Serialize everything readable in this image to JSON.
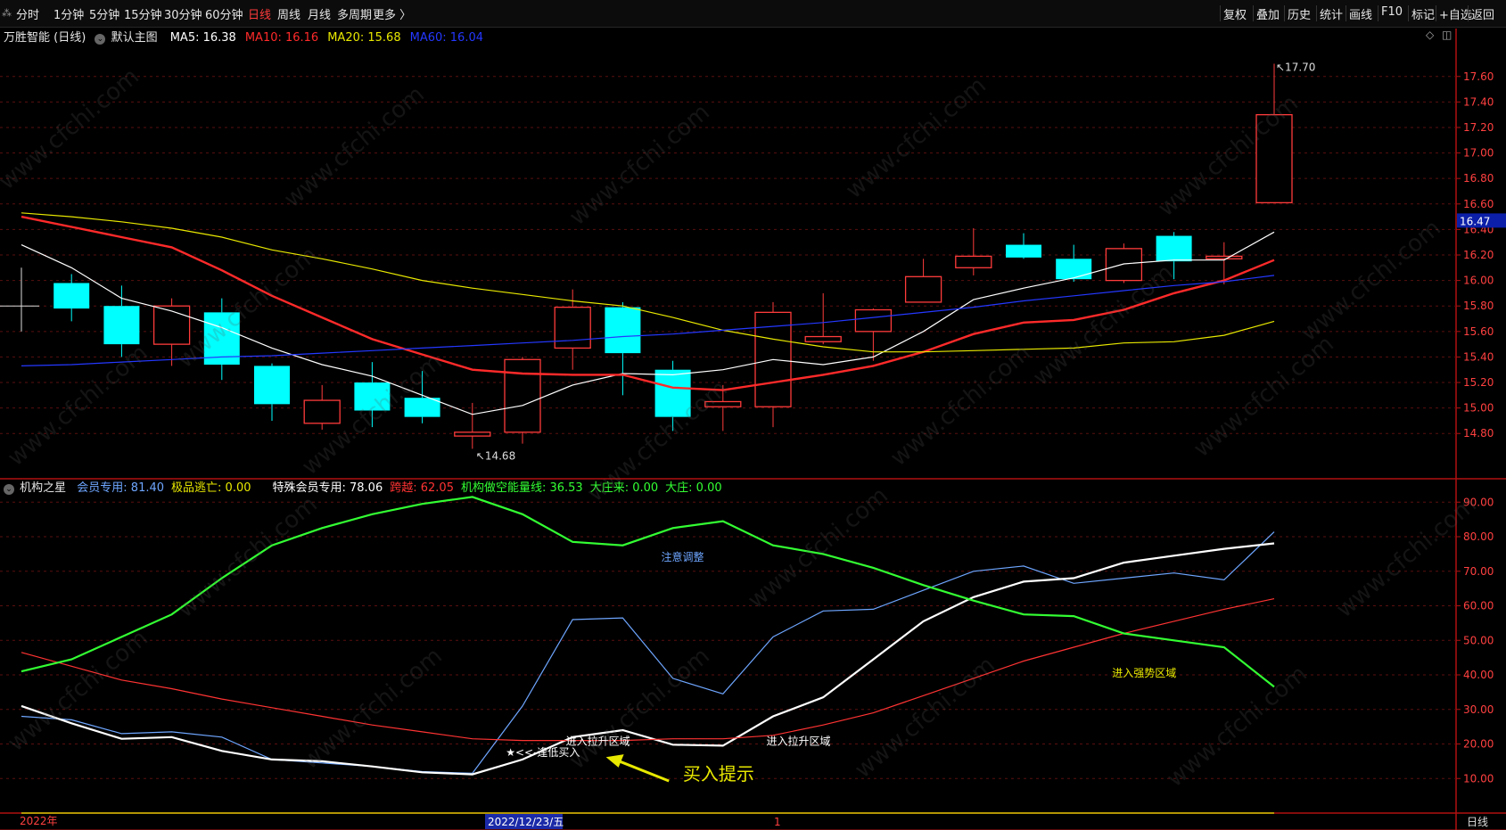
{
  "toolbar": {
    "left_mark": "⁂",
    "periods": [
      "分时",
      "1分钟",
      "5分钟",
      "15分钟",
      "30分钟",
      "60分钟",
      "日线",
      "周线",
      "月线",
      "多周期",
      "更多 〉"
    ],
    "active_period": "日线",
    "tools": [
      "复权",
      "叠加",
      "历史",
      "统计",
      "画线",
      "F10",
      "标记",
      "+自选",
      "返回"
    ]
  },
  "main_legend": {
    "title": "万胜智能 (日线)",
    "template": "默认主图",
    "ma": [
      {
        "label": "MA5: 16.38",
        "color": "#ffffff"
      },
      {
        "label": "MA10: 16.16",
        "color": "#ff2a2a"
      },
      {
        "label": "MA20: 15.68",
        "color": "#e8e800"
      },
      {
        "label": "MA60: 16.04",
        "color": "#2438ff"
      }
    ]
  },
  "sub_legend": {
    "title": "机构之星",
    "items": [
      {
        "label": "会员专用: 81.40",
        "color": "#6ea6ff"
      },
      {
        "label": "极品逃亡: 0.00",
        "color": "#e8e800"
      },
      {
        "label": "特殊会员专用: 78.06",
        "color": "#ffffff"
      },
      {
        "label": "跨越: 62.05",
        "color": "#ff3333"
      },
      {
        "label": "机构做空能量线: 36.53",
        "color": "#33ff33"
      },
      {
        "label": "大庄来: 0.00",
        "color": "#33ff33"
      },
      {
        "label": "大庄: 0.00",
        "color": "#33ff33"
      }
    ]
  },
  "watermark": "www.cfchi.com",
  "bottom_labels": {
    "year": "2022年",
    "date": "2022/12/23/五",
    "marker": "1",
    "period": "日线"
  },
  "chart_data": [
    {
      "type": "candlestick",
      "ylim": [
        14.55,
        17.85
      ],
      "ticks": [
        14.8,
        15.0,
        15.2,
        15.4,
        15.6,
        15.8,
        16.0,
        16.2,
        16.4,
        16.6,
        16.8,
        17.0,
        17.2,
        17.4,
        17.6
      ],
      "last_price": "16.47",
      "high_label": "17.70",
      "low_label": "14.68",
      "up_color": "#ff3b3b",
      "down_color": "#00ffff",
      "candles": [
        {
          "o": 15.8,
          "h": 16.1,
          "l": 15.6,
          "c": 15.8
        },
        {
          "o": 15.98,
          "h": 16.05,
          "l": 15.68,
          "c": 15.78
        },
        {
          "o": 15.8,
          "h": 15.96,
          "l": 15.4,
          "c": 15.5
        },
        {
          "o": 15.5,
          "h": 15.86,
          "l": 15.33,
          "c": 15.8
        },
        {
          "o": 15.75,
          "h": 15.86,
          "l": 15.22,
          "c": 15.34
        },
        {
          "o": 15.33,
          "h": 15.35,
          "l": 14.9,
          "c": 15.03
        },
        {
          "o": 14.88,
          "h": 15.18,
          "l": 14.83,
          "c": 15.06
        },
        {
          "o": 15.2,
          "h": 15.36,
          "l": 14.85,
          "c": 14.98
        },
        {
          "o": 15.08,
          "h": 15.29,
          "l": 14.88,
          "c": 14.93
        },
        {
          "o": 14.78,
          "h": 15.04,
          "l": 14.68,
          "c": 14.81
        },
        {
          "o": 14.81,
          "h": 15.4,
          "l": 14.72,
          "c": 15.38
        },
        {
          "o": 15.47,
          "h": 15.93,
          "l": 15.3,
          "c": 15.79
        },
        {
          "o": 15.79,
          "h": 15.83,
          "l": 15.1,
          "c": 15.43
        },
        {
          "o": 15.3,
          "h": 15.37,
          "l": 14.82,
          "c": 14.93
        },
        {
          "o": 15.01,
          "h": 15.18,
          "l": 14.82,
          "c": 15.05
        },
        {
          "o": 15.01,
          "h": 15.83,
          "l": 14.85,
          "c": 15.75
        },
        {
          "o": 15.52,
          "h": 15.9,
          "l": 15.5,
          "c": 15.56
        },
        {
          "o": 15.6,
          "h": 15.78,
          "l": 15.37,
          "c": 15.77
        },
        {
          "o": 15.83,
          "h": 16.17,
          "l": 15.83,
          "c": 16.03
        },
        {
          "o": 16.1,
          "h": 16.41,
          "l": 16.04,
          "c": 16.19
        },
        {
          "o": 16.28,
          "h": 16.37,
          "l": 16.17,
          "c": 16.18
        },
        {
          "o": 16.17,
          "h": 16.28,
          "l": 15.99,
          "c": 16.01
        },
        {
          "o": 16.0,
          "h": 16.29,
          "l": 15.98,
          "c": 16.25
        },
        {
          "o": 16.35,
          "h": 16.38,
          "l": 16.01,
          "c": 16.15
        },
        {
          "o": 16.17,
          "h": 16.3,
          "l": 15.97,
          "c": 16.19
        },
        {
          "o": 16.61,
          "h": 17.7,
          "l": 16.61,
          "c": 17.3
        }
      ],
      "series": [
        {
          "name": "MA5",
          "color": "#ffffff",
          "values": [
            16.28,
            16.1,
            15.86,
            15.76,
            15.63,
            15.47,
            15.34,
            15.25,
            15.1,
            14.95,
            15.02,
            15.18,
            15.27,
            15.26,
            15.3,
            15.38,
            15.34,
            15.4,
            15.6,
            15.85,
            15.94,
            16.02,
            16.13,
            16.16,
            16.16,
            16.38
          ]
        },
        {
          "name": "MA10",
          "color": "#ff2a2a",
          "values": [
            16.5,
            16.42,
            16.34,
            16.26,
            16.08,
            15.88,
            15.71,
            15.54,
            15.42,
            15.3,
            15.27,
            15.26,
            15.26,
            15.16,
            15.14,
            15.2,
            15.26,
            15.33,
            15.44,
            15.58,
            15.67,
            15.69,
            15.77,
            15.9,
            16.0,
            16.16
          ]
        },
        {
          "name": "MA20",
          "color": "#e8e800",
          "values": [
            16.53,
            16.5,
            16.46,
            16.41,
            16.34,
            16.24,
            16.17,
            16.09,
            16.0,
            15.94,
            15.89,
            15.84,
            15.8,
            15.71,
            15.61,
            15.54,
            15.48,
            15.44,
            15.44,
            15.45,
            15.46,
            15.47,
            15.51,
            15.52,
            15.57,
            15.68
          ]
        },
        {
          "name": "MA60",
          "color": "#2438ff",
          "values": [
            15.33,
            15.34,
            15.36,
            15.38,
            15.4,
            15.41,
            15.43,
            15.45,
            15.47,
            15.49,
            15.51,
            15.53,
            15.56,
            15.58,
            15.61,
            15.64,
            15.67,
            15.71,
            15.75,
            15.79,
            15.84,
            15.88,
            15.92,
            15.96,
            15.99,
            16.04
          ]
        }
      ]
    },
    {
      "type": "line",
      "ylim": [
        0,
        96
      ],
      "ticks": [
        10,
        20,
        30,
        40,
        50,
        60,
        70,
        80,
        90
      ],
      "tick_labels": [
        "10.00",
        "20.00",
        "30.00",
        "40.00",
        "50.00",
        "60.00",
        "70.00",
        "80.00",
        "90.00"
      ],
      "series": [
        {
          "name": "会员专用",
          "color": "#6ea6ff",
          "values": [
            28,
            27,
            23,
            23.5,
            22,
            15.5,
            14.5,
            13.5,
            12,
            11.5,
            31,
            56,
            56.5,
            39,
            34.5,
            51,
            58.5,
            59,
            64.5,
            70,
            71.5,
            66.5,
            68,
            69.5,
            67.5,
            81.4
          ]
        },
        {
          "name": "特殊会员专用",
          "color": "#ffffff",
          "values": [
            31,
            26,
            21.5,
            22,
            18,
            15.5,
            15,
            13.5,
            11.8,
            11.2,
            15.5,
            22,
            24,
            19.8,
            19.5,
            28,
            33.5,
            44.5,
            55.5,
            62.5,
            67,
            68,
            72.5,
            74.5,
            76.5,
            78.06
          ]
        },
        {
          "name": "跨越",
          "color": "#ff3333",
          "values": [
            46.5,
            42.5,
            38.5,
            36,
            33,
            30.5,
            28,
            25.5,
            23.5,
            21.5,
            21,
            21,
            21,
            21.5,
            21.5,
            22.5,
            25.5,
            29,
            34,
            39,
            44,
            48,
            52,
            55.5,
            59,
            62.05
          ]
        },
        {
          "name": "机构做空能量线",
          "color": "#33ff33",
          "values": [
            41,
            44.5,
            51,
            57.5,
            68,
            77.5,
            82.5,
            86.5,
            89.5,
            91.5,
            86.5,
            78.5,
            77.5,
            82.5,
            84.5,
            77.5,
            75,
            71,
            66,
            61.5,
            57.5,
            57,
            52,
            50,
            48,
            36.53
          ]
        },
        {
          "name": "极品逃亡",
          "color": "#e8e800",
          "values": [
            0,
            0,
            0,
            0,
            0,
            0,
            0,
            0,
            0,
            0,
            0,
            0,
            0,
            0,
            0,
            0,
            0,
            0,
            0,
            0,
            0,
            0,
            0,
            0,
            0,
            0
          ]
        }
      ],
      "annotations": [
        {
          "text": "注意调整",
          "color": "#6ea6ff",
          "xi": 13.3,
          "y": 73
        },
        {
          "text": "进入强势区域",
          "color": "#e8e800",
          "xi": 22.3,
          "y": 39.5
        },
        {
          "text": "进入拉升区域",
          "color": "#ffffff",
          "xi": 11.4,
          "y": 19.7
        },
        {
          "text": "进入拉升区域",
          "color": "#ffffff",
          "xi": 15.4,
          "y": 19.7
        },
        {
          "text": "★<<-逢低买入",
          "color": "#ffffff",
          "xi": 10.2,
          "y": 16.5
        },
        {
          "text": "买入提示",
          "color": "#e8e800",
          "xi": 13.2,
          "y": 9.5
        }
      ]
    }
  ]
}
